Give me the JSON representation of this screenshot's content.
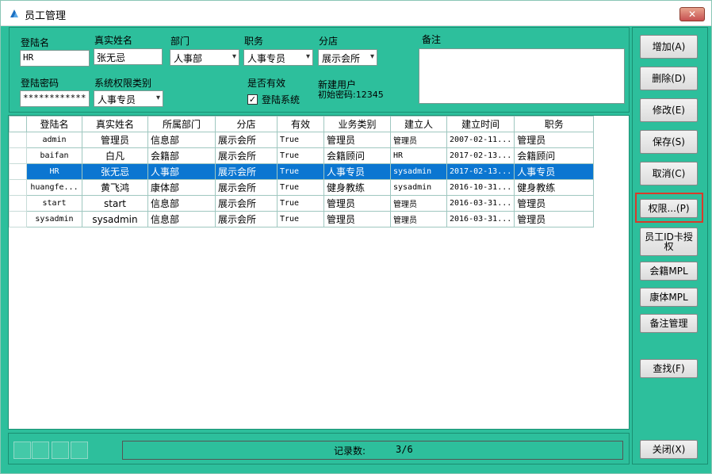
{
  "window": {
    "title": "员工管理",
    "close_label": "✕"
  },
  "form": {
    "login_name_label": "登陆名",
    "login_name_value": "HR",
    "real_name_label": "真实姓名",
    "real_name_value": "张无忌",
    "dept_label": "部门",
    "dept_value": "人事部",
    "position_label": "职务",
    "position_value": "人事专员",
    "branch_label": "分店",
    "branch_value": "展示会所",
    "memo_label": "备注",
    "memo_value": "",
    "password_label": "登陆密码",
    "password_value": "************",
    "perm_type_label": "系统权限类别",
    "perm_type_value": "人事专员",
    "valid_label": "是否有效",
    "login_system_label": "登陆系统",
    "login_system_checked": "✓",
    "new_user_label": "新建用户",
    "initial_password_label": "初始密码:12345"
  },
  "grid": {
    "headers": [
      "登陆名",
      "真实姓名",
      "所属部门",
      "分店",
      "有效",
      "业务类别",
      "建立人",
      "建立时间",
      "职务"
    ],
    "rows": [
      [
        "admin",
        "管理员",
        "信息部",
        "展示会所",
        "True",
        "管理员",
        "管理员",
        "2007-02-11...",
        "管理员"
      ],
      [
        "baifan",
        "白凡",
        "会籍部",
        "展示会所",
        "True",
        "会籍顾问",
        "HR",
        "2017-02-13...",
        "会籍顾问"
      ],
      [
        "HR",
        "张无忌",
        "人事部",
        "展示会所",
        "True",
        "人事专员",
        "sysadmin",
        "2017-02-13...",
        "人事专员"
      ],
      [
        "huangfe...",
        "黄飞鸿",
        "康体部",
        "展示会所",
        "True",
        "健身教练",
        "sysadmin",
        "2016-10-31...",
        "健身教练"
      ],
      [
        "start",
        "start",
        "信息部",
        "展示会所",
        "True",
        "管理员",
        "管理员",
        "2016-03-31...",
        "管理员"
      ],
      [
        "sysadmin",
        "sysadmin",
        "信息部",
        "展示会所",
        "True",
        "管理员",
        "管理员",
        "2016-03-31...",
        "管理员"
      ]
    ],
    "selected_row": 2
  },
  "status": {
    "record_label": "记录数:",
    "record_value": "3/6"
  },
  "buttons": {
    "add": "增加(A)",
    "delete": "删除(D)",
    "modify": "修改(E)",
    "save": "保存(S)",
    "cancel": "取消(C)",
    "permission": "权限...(P)",
    "card_auth": "员工ID卡授权",
    "membership_mpl": "会籍MPL",
    "fitness_mpl": "康体MPL",
    "memo_manage": "备注管理",
    "find": "查找(F)",
    "close": "关闭(X)"
  },
  "colors": {
    "panel": "#2dbf9c",
    "selection": "#0b76d1",
    "highlight_border": "#d93a2a"
  }
}
